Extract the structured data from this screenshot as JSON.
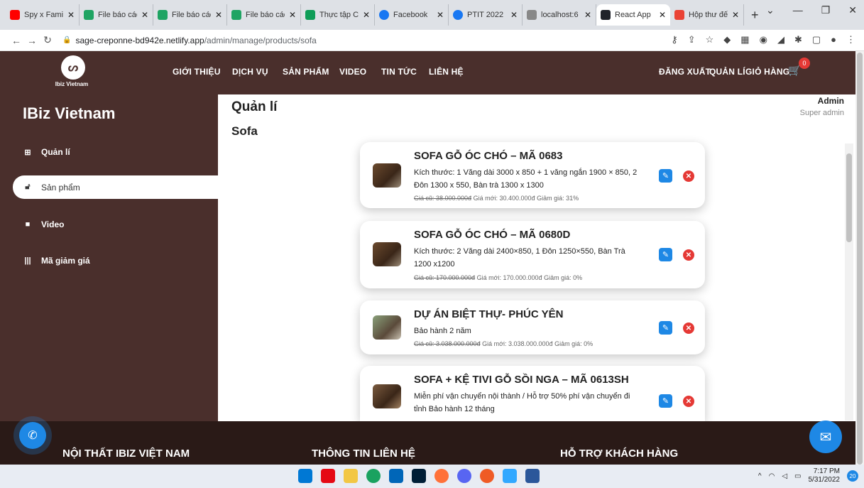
{
  "browser": {
    "tabs": [
      {
        "title": "Spy x Famil",
        "icon": "youtube-icon",
        "color": "#ff0000"
      },
      {
        "title": "File báo các",
        "icon": "drive-icon",
        "color": "#1fa463"
      },
      {
        "title": "File báo các",
        "icon": "drive-icon",
        "color": "#1fa463"
      },
      {
        "title": "File báo các",
        "icon": "drive-icon",
        "color": "#1fa463"
      },
      {
        "title": "Thực tập C",
        "icon": "sheets-icon",
        "color": "#0f9d58"
      },
      {
        "title": "Facebook",
        "icon": "facebook-icon",
        "color": "#1877f2"
      },
      {
        "title": "PTIT 2022",
        "icon": "facebook-icon",
        "color": "#1877f2"
      },
      {
        "title": "localhost:6",
        "icon": "localhost-icon",
        "color": "#888888"
      },
      {
        "title": "React App",
        "icon": "react-icon",
        "color": "#20232a"
      },
      {
        "title": "Hộp thư đế",
        "icon": "gmail-icon",
        "color": "#ea4335"
      }
    ],
    "url_host": "sage-creponne-bd942e.netlify.app",
    "url_path": "/admin/manage/products/sofa"
  },
  "nav": {
    "logo_text": "Ibiz Vietnam",
    "items": [
      "GIỚI THIỆU",
      "DỊCH VỤ",
      "SẢN PHẨM",
      "VIDEO",
      "TIN TỨC",
      "LIÊN HỆ"
    ],
    "right_items": [
      "ĐĂNG XUẤT",
      "QUẢN LÍ",
      "GIỎ HÀNG"
    ],
    "cart_count": "0"
  },
  "sidebar": {
    "brand": "IBiz Vietnam",
    "items": [
      {
        "label": "Quản lí",
        "icon": "grid-icon"
      },
      {
        "label": "Sản phẩm",
        "icon": "lock-icon"
      },
      {
        "label": "Video",
        "icon": "video-icon"
      },
      {
        "label": "Mã giảm giá",
        "icon": "barcode-icon"
      }
    ],
    "active_index": 1
  },
  "main": {
    "title": "Quản lí",
    "subtitle": "Sofa"
  },
  "user": {
    "name": "Admin",
    "role": "Super admin"
  },
  "products": [
    {
      "title": "SOFA GỖ ÓC CHÓ – MÃ 0683",
      "desc": "Kích thước: 1 Văng dài 3000 x 850 + 1 văng ngắn 1900 × 850, 2 Đôn 1300 x 550, Bàn trà 1300 x 1300",
      "old_price": "Giá cũ: 38.000.000đ",
      "new_price": "Giá mới: 30.400.000đ",
      "discount": "Giảm giá: 31%"
    },
    {
      "title": "SOFA GỖ ÓC CHÓ – MÃ 0680D",
      "desc": "Kích thước: 2 Văng dài 2400×850, 1 Đôn 1250×550, Bàn Trà 1200 x1200",
      "old_price": "Giá cũ: 170.000.000đ",
      "new_price": "Giá mới: 170.000.000đ",
      "discount": "Giảm giá: 0%"
    },
    {
      "title": "DỰ ÁN BIỆT THỰ- PHÚC YÊN",
      "desc": "Bảo hành 2 năm",
      "old_price": "Giá cũ: 3.038.000.000đ",
      "new_price": "Giá mới: 3.038.000.000đ",
      "discount": "Giảm giá: 0%"
    },
    {
      "title": "SOFA + KỆ TIVI GỖ SỒI NGA – MÃ 0613SH",
      "desc": "Miễn phí vận chuyển nội thành / Hỗ trợ 50% phí vận chuyển đi tỉnh Bảo hành 12 tháng",
      "old_price": "",
      "new_price": "",
      "discount": ""
    }
  ],
  "footer": {
    "headings": [
      "NỘI THẤT IBIZ VIỆT NAM",
      "THÔNG TIN LIÊN HỆ",
      "HỖ TRỢ KHÁCH HÀNG"
    ]
  },
  "taskbar": {
    "time": "7:17 PM",
    "date": "5/31/2022",
    "notifications": "20"
  },
  "colors": {
    "brand_brown": "#4a2f2c",
    "footer_dark": "#2a1a17",
    "edit_blue": "#1e88e5",
    "delete_red": "#e53935"
  }
}
